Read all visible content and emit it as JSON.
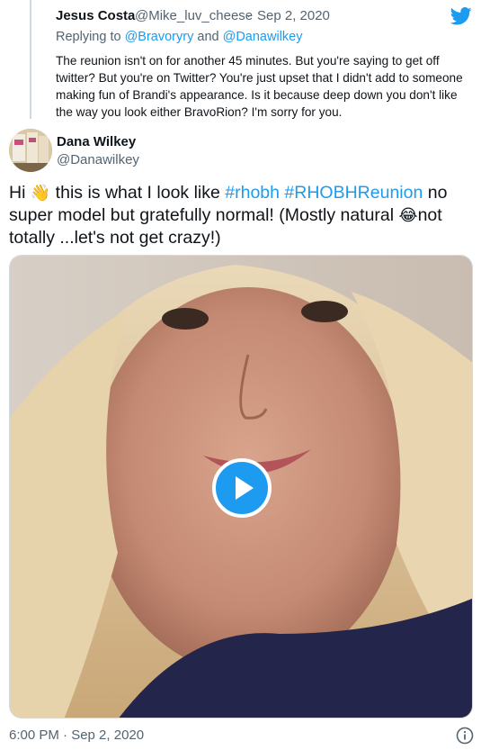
{
  "reply": {
    "name": "Jesus Costa",
    "handle": "@Mike_luv_cheese",
    "separator": "·",
    "date": "Sep 2, 2020",
    "replying_prefix": "Replying to",
    "replying_user1": "@Bravoryry",
    "replying_and": "and",
    "replying_user2": "@Danawilkey",
    "text": "The reunion isn't on for another 45 minutes. But you're saying to get off twitter? But you're on Twitter? You're just upset that I didn't add to someone making fun of Brandi's appearance. Is it because deep down you don't like the way you look either BravoRion? I'm sorry for you."
  },
  "main": {
    "name": "Dana Wilkey",
    "handle": "@Danawilkey",
    "text_part1": "Hi ",
    "emoji_wave": "👋",
    "text_part2": " this is what I look like ",
    "hashtag1": "#rhobh",
    "hashtag2": "#RHOBHReunion",
    "text_part3": " no super model but gratefully normal! (Mostly natural ",
    "emoji_laugh": "😂",
    "text_part4": "not totally ...let's not get crazy!)"
  },
  "footer": {
    "timestamp": "6:00 PM · Sep 2, 2020"
  },
  "colors": {
    "accent": "#1d9bf0",
    "secondary_text": "#536471",
    "border": "#cfd9de"
  },
  "icons": [
    "twitter-bird-icon",
    "play-icon",
    "info-icon"
  ]
}
